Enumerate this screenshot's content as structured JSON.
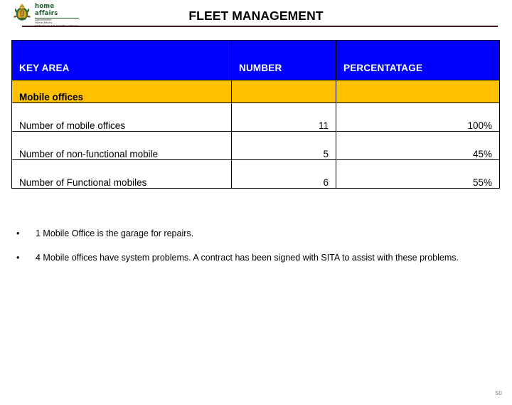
{
  "header": {
    "title": "FLEET MANAGEMENT",
    "logo": {
      "wordmark": "home affairs",
      "dept_line1": "Department:",
      "dept_line2": "Home Affairs",
      "dept_line3": "REPUBLIC OF SOUTH AFRICA",
      "emblem_name": "south-african-coat-of-arms"
    }
  },
  "table": {
    "columns": [
      "KEY AREA",
      "NUMBER",
      "PERCENTATAGE"
    ],
    "section_row": {
      "label": "Mobile offices",
      "number": "",
      "percentage": ""
    },
    "rows": [
      {
        "key_area": "Number of mobile offices",
        "number": "11",
        "percentage": "100%"
      },
      {
        "key_area": "Number of non-functional mobile",
        "number": "5",
        "percentage": "45%"
      },
      {
        "key_area": "Number of Functional mobiles",
        "number": "6",
        "percentage": "55%"
      }
    ]
  },
  "bullets": [
    {
      "marker": "•",
      "text": "1 Mobile Office is the garage for repairs."
    },
    {
      "marker": "•",
      "text": "4 Mobile offices have system problems. A contract has been signed with SITA to assist with these problems."
    }
  ],
  "footer": {
    "page_number": "50"
  },
  "colors": {
    "header_blue": "#0000ff",
    "section_yellow": "#ffc000",
    "rule_maroon": "#3d1515",
    "page_number_gray": "#808080",
    "logo_green": "#1d5c2e"
  }
}
